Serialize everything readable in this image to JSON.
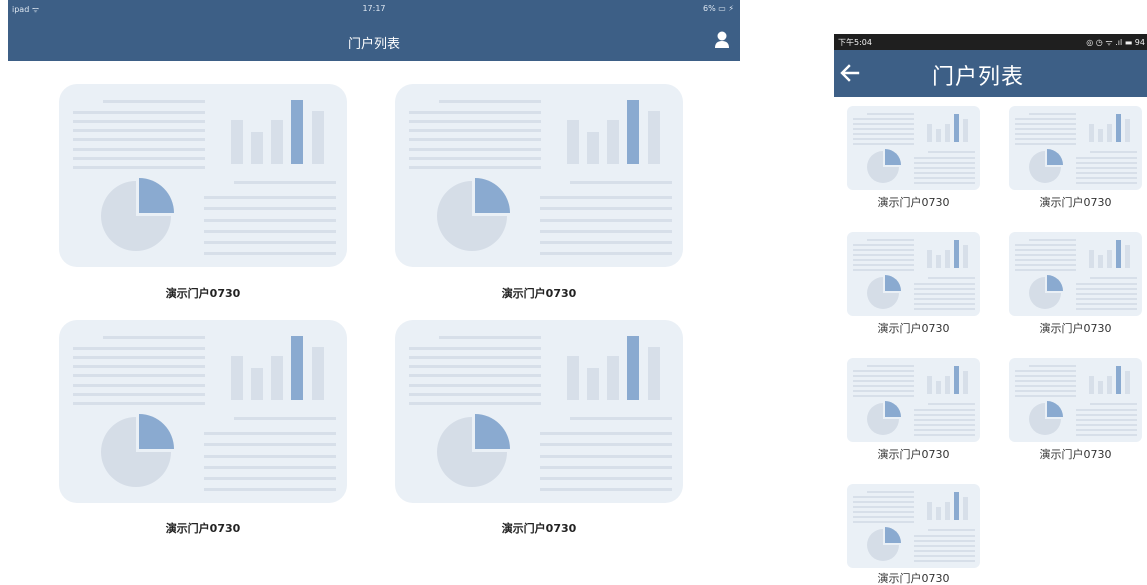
{
  "ipad": {
    "status": {
      "carrier": "ipad ᯤ",
      "time": "17:17",
      "battery": "6% ▭ ⚡"
    },
    "title": "门户列表",
    "user_icon": "user-icon",
    "portals": [
      {
        "label": "演示门户0730"
      },
      {
        "label": "演示门户0730"
      },
      {
        "label": "演示门户0730"
      },
      {
        "label": "演示门户0730"
      }
    ]
  },
  "phone": {
    "status": {
      "time": "下午5:04",
      "indicators": "◎ ◷ ᯤ .ıl ▬ 94"
    },
    "title": "门户列表",
    "back_icon": "arrow-left-icon",
    "portals": [
      {
        "label": "演示门户0730"
      },
      {
        "label": "演示门户0730"
      },
      {
        "label": "演示门户0730"
      },
      {
        "label": "演示门户0730"
      },
      {
        "label": "演示门户0730"
      },
      {
        "label": "演示门户0730"
      },
      {
        "label": "演示门户0730"
      }
    ]
  },
  "colors": {
    "header": "#3d5f86",
    "card_bg": "#eaf0f6",
    "line": "#d7dfe9",
    "accent": "#8aaad0",
    "pie": "#d5dde7"
  }
}
